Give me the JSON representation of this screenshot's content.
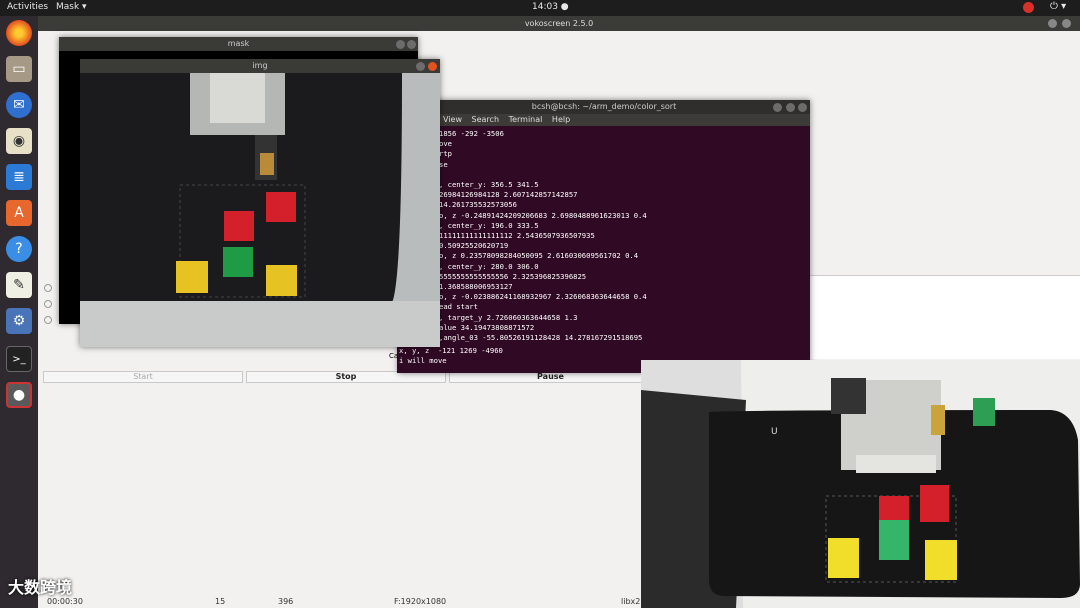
{
  "topbar": {
    "activities": "Activities",
    "app_menu": "Mask ▾",
    "clock": "14:03 ●",
    "power_icon": "⏻ ▾"
  },
  "voko": {
    "title": "vokoscreen 2.5.0",
    "buttons": {
      "start": "Start",
      "stop": "Stop",
      "pause": "Pause"
    },
    "status": {
      "time": "00:00:30",
      "fps": "15",
      "frames": "396",
      "format": "F:1920x1080",
      "codec": "libx2"
    }
  },
  "mask_window": {
    "title": "mask"
  },
  "img_window": {
    "title": "img"
  },
  "terminal": {
    "title": "bcsh@bcsh: ~/arm_demo/color_sort",
    "menu": [
      "View",
      "Search",
      "Terminal",
      "Help"
    ],
    "lines": [
      "1856 -292 -3506",
      "ove",
      "rtp",
      "se",
      "",
      ", center_y: 356.5 341.5",
      "26984126984128 2.607142857142857",
      "14.261735532573056",
      "o, z -0.2489142420920668З 2.6980488961623013 0.4",
      ", center_y: 196.0 333.5",
      "11111111111111112 2.5436507936507935",
      "0.50925520620719",
      "o, z 0.23578098284050095 2.616030609561702 0.4",
      ", center_y: 280.0 306.0",
      "5555555555555556 2.325396825396825",
      "1.368588006953127",
      "o, z -0.023886241168932967 2.326068363644658 0.4",
      "ead start",
      ", target_y 2.726060363644658 1.3",
      "alue 34.19473808871572",
      ",angle_03 -55.80526191128428 14.278167291518695"
    ],
    "low_lines": [
      "x, y, z  -121 1269 -4960",
      "i will move"
    ],
    "overlap": "Ca"
  },
  "dock": [
    "firefox-icon",
    "files-icon",
    "thunderbird-icon",
    "rhythmbox-icon",
    "writer-icon",
    "software-icon",
    "help-icon",
    "text-editor-icon",
    "settings-icon",
    "terminal-icon",
    "vokoscreen-icon"
  ],
  "watermark": "大数跨境",
  "colors": {
    "red_block": "#d3202a",
    "green_block": "#1f9a45",
    "yellow_block": "#e6c223",
    "terminal_bg": "#300a24"
  }
}
